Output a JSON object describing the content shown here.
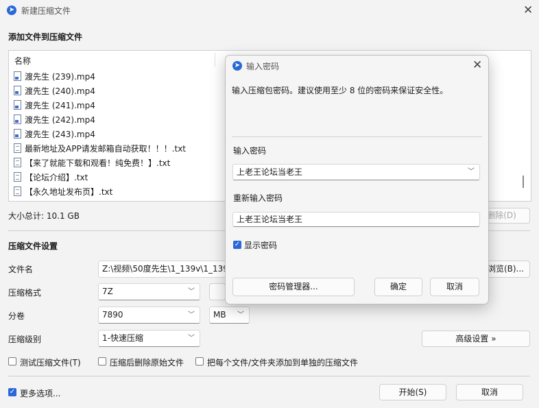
{
  "window": {
    "title": "新建压缩文件"
  },
  "files": {
    "section_title": "添加文件到压缩文件",
    "column_name": "名称",
    "items": [
      {
        "name": "渡先生 (239).mp4",
        "type": "mp4"
      },
      {
        "name": "渡先生 (240).mp4",
        "type": "mp4"
      },
      {
        "name": "渡先生 (241).mp4",
        "type": "mp4"
      },
      {
        "name": "渡先生 (242).mp4",
        "type": "mp4"
      },
      {
        "name": "渡先生 (243).mp4",
        "type": "mp4"
      },
      {
        "name": "最新地址及APP请发邮箱自动获取！！！.txt",
        "type": "txt"
      },
      {
        "name": "【来了就能下载和观看！纯免费！】.txt",
        "type": "txt"
      },
      {
        "name": "【论坛介绍】.txt",
        "type": "txt"
      },
      {
        "name": "【永久地址发布页】.txt",
        "type": "txt"
      }
    ],
    "total_size": "大小总计: 10.1 GB",
    "delete_label": "删除(D)"
  },
  "settings": {
    "section_title": "压缩文件设置",
    "filename_label": "文件名",
    "filename_value": "Z:\\视频\\50度先生\\1_139v\\1_139v",
    "browse_label": "浏览(B)...",
    "format_label": "压缩格式",
    "format_value": "7Z",
    "volume_label": "分卷",
    "volume_value": "7890",
    "volume_unit": "MB",
    "level_label": "压缩级别",
    "level_value": "1-快速压缩",
    "advanced_label": "高级设置 »",
    "test_label": "测试压缩文件(T)",
    "delete_after_label": "压缩后删除原始文件",
    "each_separate_label": "把每个文件/文件夹添加到单独的压缩文件"
  },
  "footer": {
    "more_options": "更多选项...",
    "start": "开始(S)",
    "cancel": "取消"
  },
  "password_dialog": {
    "title": "输入密码",
    "description": "输入压缩包密码。建议使用至少 8 位的密码来保证安全性。",
    "enter_label": "输入密码",
    "password_value": "上老王论坛当老王",
    "reenter_label": "重新输入密码",
    "reenter_value": "上老王论坛当老王",
    "show_password": "显示密码",
    "manager_label": "密码管理器...",
    "ok_label": "确定",
    "cancel_label": "取消"
  },
  "colors": {
    "accent": "#2a68d8",
    "background": "#f3f3f3"
  }
}
